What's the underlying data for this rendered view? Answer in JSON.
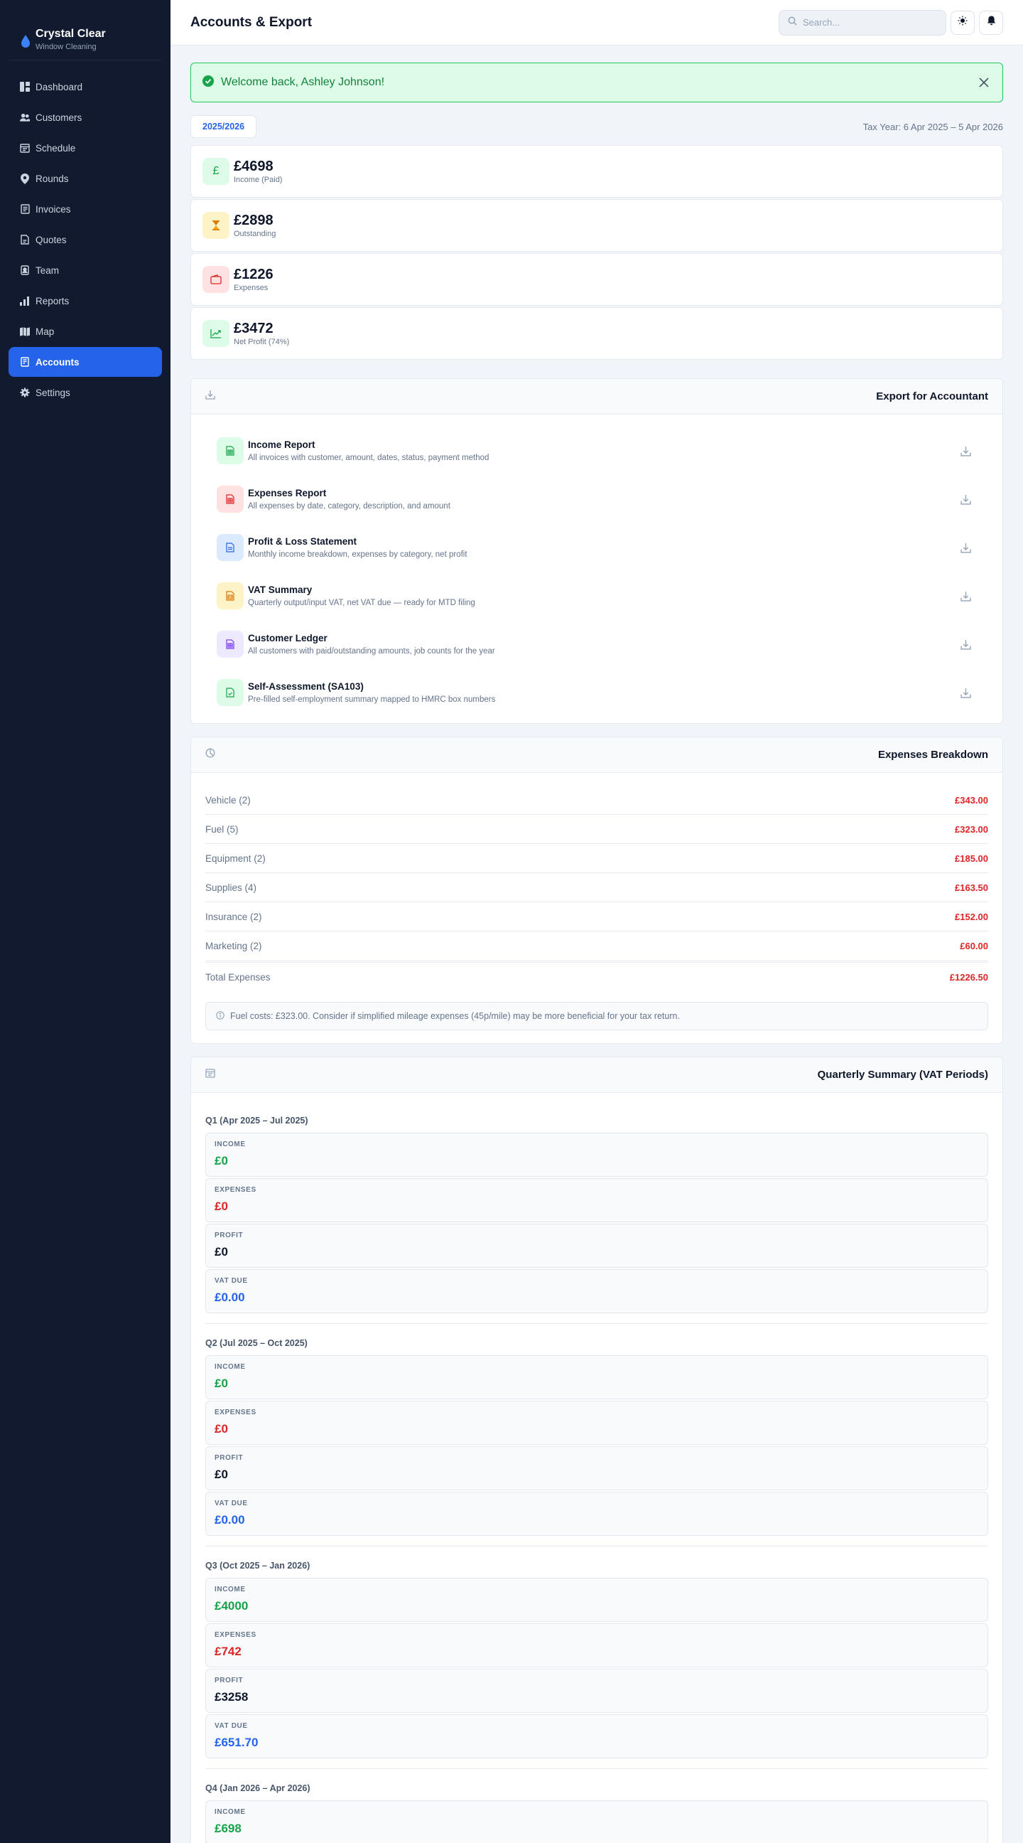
{
  "app": {
    "name": "Crystal Clear",
    "subtitle": "Window Cleaning"
  },
  "sidebar": {
    "items": [
      {
        "label": "Dashboard",
        "icon": "dashboard-icon"
      },
      {
        "label": "Customers",
        "icon": "users-icon"
      },
      {
        "label": "Schedule",
        "icon": "calendar-icon"
      },
      {
        "label": "Rounds",
        "icon": "map-pin-icon"
      },
      {
        "label": "Invoices",
        "icon": "invoice-icon"
      },
      {
        "label": "Quotes",
        "icon": "quote-icon"
      },
      {
        "label": "Team",
        "icon": "id-badge-icon"
      },
      {
        "label": "Reports",
        "icon": "bar-chart-icon"
      },
      {
        "label": "Map",
        "icon": "map-icon"
      },
      {
        "label": "Accounts",
        "icon": "ledger-icon",
        "active": true
      },
      {
        "label": "Settings",
        "icon": "gear-icon"
      }
    ]
  },
  "header": {
    "title": "Accounts & Export",
    "search_placeholder": "Search..."
  },
  "alert": {
    "message": "Welcome back, Ashley Johnson!"
  },
  "year": {
    "tab": "2025/2026",
    "tax_year": "Tax Year: 6 Apr 2025 – 5 Apr 2026"
  },
  "stats": [
    {
      "value": "£4698",
      "label": "Income (Paid)",
      "icon": "pound-icon",
      "color": "#16a34a",
      "bg": "#dcfce7"
    },
    {
      "value": "£2898",
      "label": "Outstanding",
      "icon": "hourglass-icon",
      "color": "#d97706",
      "bg": "#fef3c7"
    },
    {
      "value": "£1226",
      "label": "Expenses",
      "icon": "wallet-icon",
      "color": "#dc2626",
      "bg": "#fee2e2"
    },
    {
      "value": "£3472",
      "label": "Net Profit (74%)",
      "icon": "trend-up-icon",
      "color": "#16a34a",
      "bg": "#dcfce7"
    }
  ],
  "export": {
    "title": "Export for Accountant",
    "items": [
      {
        "title": "Income Report",
        "desc": "All invoices with customer, amount, dates, status, payment method",
        "color": "#16a34a",
        "bg": "#dcfce7"
      },
      {
        "title": "Expenses Report",
        "desc": "All expenses by date, category, description, and amount",
        "color": "#dc2626",
        "bg": "#fee2e2"
      },
      {
        "title": "Profit & Loss Statement",
        "desc": "Monthly income breakdown, expenses by category, net profit",
        "color": "#2563eb",
        "bg": "#dbeafe"
      },
      {
        "title": "VAT Summary",
        "desc": "Quarterly output/input VAT, net VAT due — ready for MTD filing",
        "color": "#d97706",
        "bg": "#fef3c7"
      },
      {
        "title": "Customer Ledger",
        "desc": "All customers with paid/outstanding amounts, job counts for the year",
        "color": "#7c3aed",
        "bg": "#ede9fe"
      },
      {
        "title": "Self-Assessment (SA103)",
        "desc": "Pre-filled self-employment summary mapped to HMRC box numbers",
        "color": "#16a34a",
        "bg": "#dcfce7"
      }
    ]
  },
  "expenses": {
    "title": "Expenses Breakdown",
    "rows": [
      {
        "name": "Vehicle (2)",
        "amount": "£343.00"
      },
      {
        "name": "Fuel (5)",
        "amount": "£323.00"
      },
      {
        "name": "Equipment (2)",
        "amount": "£185.00"
      },
      {
        "name": "Supplies (4)",
        "amount": "£163.50"
      },
      {
        "name": "Insurance (2)",
        "amount": "£152.00"
      },
      {
        "name": "Marketing (2)",
        "amount": "£60.00"
      }
    ],
    "total_label": "Total Expenses",
    "total_amount": "£1226.50",
    "tip": "Fuel costs: £323.00. Consider if simplified mileage expenses (45p/mile) may be more beneficial for your tax return."
  },
  "quarterly": {
    "title": "Quarterly Summary (VAT Periods)",
    "labels": {
      "income": "INCOME",
      "expenses": "EXPENSES",
      "profit": "PROFIT",
      "vat": "VAT DUE"
    },
    "quarters": [
      {
        "title": "Q1 (Apr 2025 – Jul 2025)",
        "income": "£0",
        "expenses": "£0",
        "profit": "£0",
        "vat": "£0.00"
      },
      {
        "title": "Q2 (Jul 2025 – Oct 2025)",
        "income": "£0",
        "expenses": "£0",
        "profit": "£0",
        "vat": "£0.00"
      },
      {
        "title": "Q3 (Oct 2025 – Jan 2026)",
        "income": "£4000",
        "expenses": "£742",
        "profit": "£3258",
        "vat": "£651.70"
      },
      {
        "title": "Q4 (Jan 2026 – Apr 2026)",
        "income": "£698",
        "expenses": "",
        "profit": "",
        "vat": ""
      }
    ]
  },
  "colors": {
    "primary": "#2563eb",
    "income": "#16a34a",
    "expense": "#dc2626",
    "sidebar_bg": "#111a2e"
  }
}
